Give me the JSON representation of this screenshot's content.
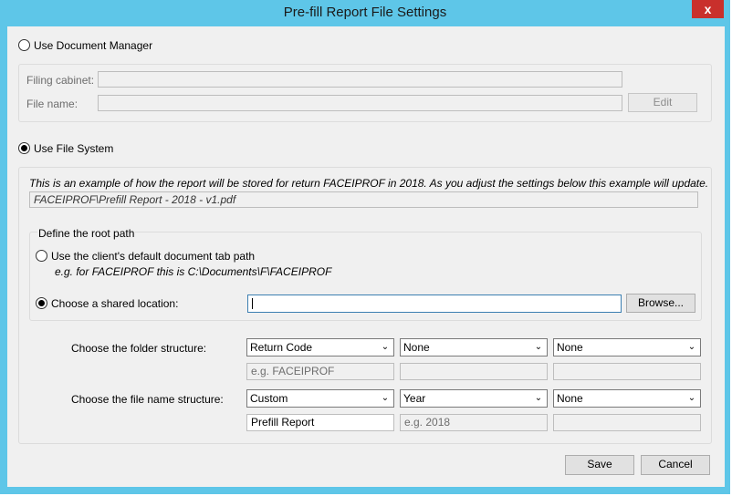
{
  "window": {
    "title": "Pre-fill Report File Settings",
    "close_label": "x"
  },
  "document_manager": {
    "radio_label": "Use Document Manager",
    "filing_cabinet_label": "Filing cabinet:",
    "filing_cabinet_value": "",
    "file_name_label": "File name:",
    "file_name_value": "",
    "edit_label": "Edit"
  },
  "file_system": {
    "radio_label": "Use File System",
    "example_text": "This is an example of how the report will be stored for return FACEIPROF in 2018. As you adjust the settings below this example will update.",
    "example_path": "FACEIPROF\\Prefill Report - 2018 - v1.pdf",
    "root_path": {
      "group_label": "Define the root path",
      "default_path_label": "Use the client's default document tab path",
      "default_path_example": "e.g. for FACEIPROF this is C:\\Documents\\F\\FACEIPROF",
      "shared_label": "Choose a shared location:",
      "shared_value": "",
      "browse_label": "Browse..."
    },
    "folder_structure": {
      "label": "Choose the folder structure:",
      "combos": [
        "Return Code",
        "None",
        "None"
      ],
      "previews": [
        "e.g. FACEIPROF",
        "",
        ""
      ]
    },
    "file_name_structure": {
      "label": "Choose the file name structure:",
      "combos": [
        "Custom",
        "Year",
        "None"
      ],
      "inputs": [
        "Prefill Report",
        "e.g. 2018",
        ""
      ]
    }
  },
  "footer": {
    "save_label": "Save",
    "cancel_label": "Cancel"
  }
}
